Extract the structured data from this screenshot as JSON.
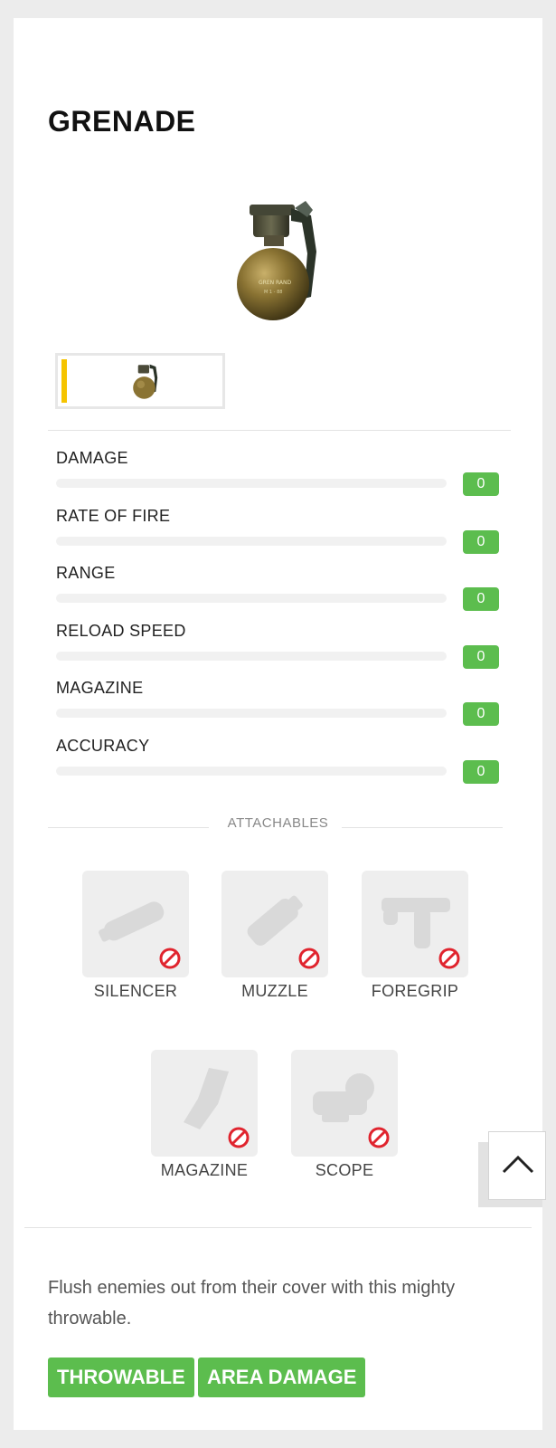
{
  "item": {
    "title": "GRENADE",
    "description": "Flush enemies out from their cover with this mighty throwable."
  },
  "stats": [
    {
      "label": "DAMAGE",
      "value": "0",
      "fraction": 0
    },
    {
      "label": "RATE OF FIRE",
      "value": "0",
      "fraction": 0
    },
    {
      "label": "RANGE",
      "value": "0",
      "fraction": 0
    },
    {
      "label": "RELOAD SPEED",
      "value": "0",
      "fraction": 0
    },
    {
      "label": "MAGAZINE",
      "value": "0",
      "fraction": 0
    },
    {
      "label": "ACCURACY",
      "value": "0",
      "fraction": 0
    }
  ],
  "attachables": {
    "heading": "ATTACHABLES",
    "items": [
      {
        "label": "SILENCER",
        "icon": "silencer-icon",
        "available": false
      },
      {
        "label": "MUZZLE",
        "icon": "muzzle-icon",
        "available": false
      },
      {
        "label": "FOREGRIP",
        "icon": "foregrip-icon",
        "available": false
      },
      {
        "label": "MAGAZINE",
        "icon": "magazine-icon",
        "available": false
      },
      {
        "label": "SCOPE",
        "icon": "scope-icon",
        "available": false
      }
    ]
  },
  "tags": [
    "THROWABLE",
    "AREA DAMAGE"
  ],
  "colors": {
    "accent_green": "#5cbd4e",
    "selected_indicator": "#f5c400",
    "unavailable_red": "#e0242e"
  },
  "scroll_to_top": {
    "icon": "chevron-up-icon"
  }
}
